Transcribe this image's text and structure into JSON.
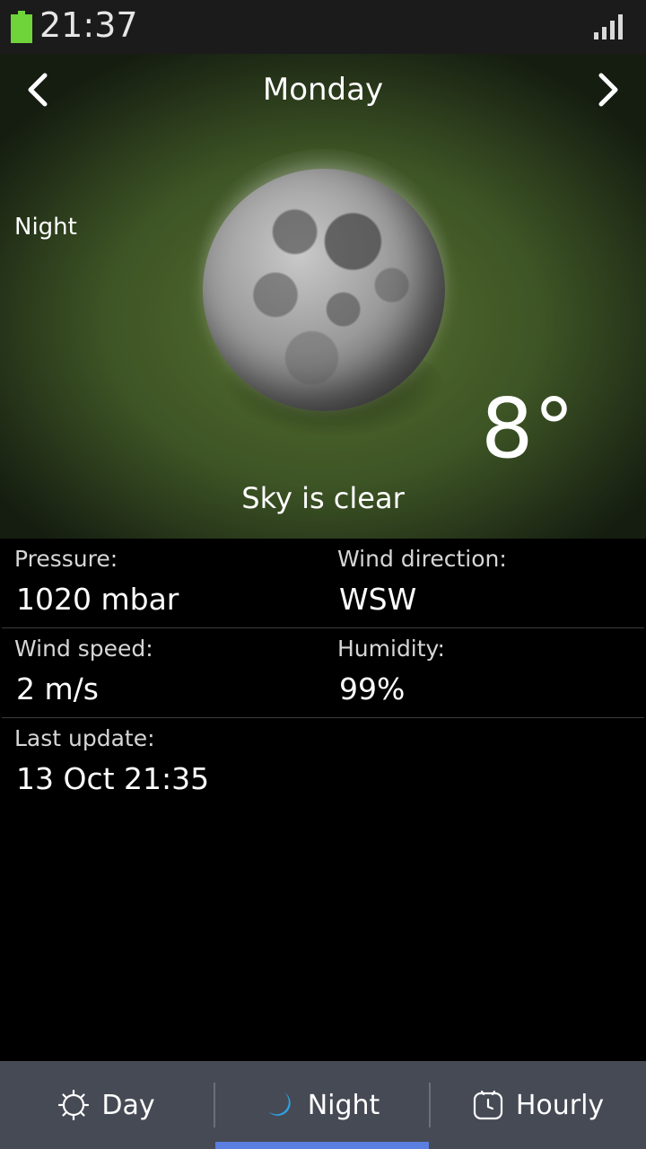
{
  "status_bar": {
    "time": "21:37",
    "battery_icon": "battery-icon",
    "signal_icon": "signal-icon",
    "battery_color": "#6fd33a"
  },
  "header": {
    "day": "Monday",
    "prev_icon": "chevron-left-icon",
    "next_icon": "chevron-right-icon"
  },
  "weather": {
    "period": "Night",
    "icon": "moon-icon",
    "temperature": "8°",
    "condition": "Sky is clear"
  },
  "details": {
    "pressure_label": "Pressure:",
    "pressure_value": "1020 mbar",
    "wind_direction_label": "Wind direction:",
    "wind_direction_value": "WSW",
    "wind_speed_label": "Wind speed:",
    "wind_speed_value": "2 m/s",
    "humidity_label": "Humidity:",
    "humidity_value": "99%",
    "last_update_label": "Last update:",
    "last_update_value": "13 Oct 21:35"
  },
  "tabs": [
    {
      "label": "Day",
      "icon": "sun-icon",
      "selected": false
    },
    {
      "label": "Night",
      "icon": "crescent-moon-icon",
      "selected": true
    },
    {
      "label": "Hourly",
      "icon": "clock-icon",
      "selected": false
    }
  ],
  "colors": {
    "accent": "#5b7fe0",
    "moon_accent": "#2ea3e6",
    "tabbar": "#464a55"
  }
}
